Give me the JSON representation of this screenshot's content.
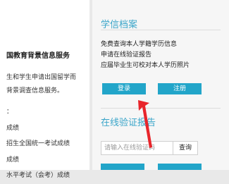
{
  "left_panel": {
    "service_title": "国教育背景信息服务",
    "desc_line1": "生和学生申请出国留学而",
    "desc_line2": "背景调查信息服务。",
    "items": [
      "：",
      "成绩",
      "招生全国统一考试成绩",
      "成绩",
      "水平考试（会考）成绩"
    ]
  },
  "xuexin": {
    "title": "学信档案",
    "links": [
      "免费查询本人学籍学历信息",
      "申请在线验证报告",
      "应届毕业生可校对本人学历照片"
    ],
    "login_label": "登录",
    "register_label": "注册"
  },
  "verify": {
    "title": "在线验证报告",
    "input_placeholder": "请输入在线验证码",
    "query_label": "查询"
  },
  "colors": {
    "accent": "#22a5c9",
    "title_blue": "#3aa5c9",
    "annotation_red": "#e8252b"
  },
  "icons": {
    "annotation": "red-arrow-icon"
  }
}
